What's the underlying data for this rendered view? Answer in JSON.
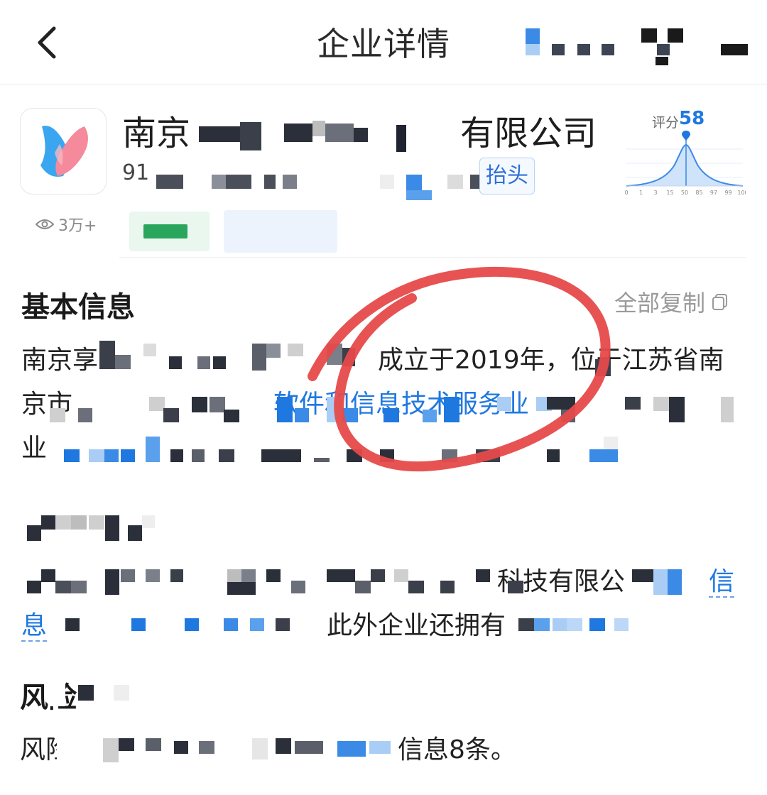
{
  "header": {
    "title": "企业详情"
  },
  "company": {
    "name_start": "南京",
    "name_end": "有限公司",
    "credit_code_start": "91",
    "tag_text": "抬头",
    "views": "3万+"
  },
  "score": {
    "label": "评分",
    "value": "58",
    "ticks": [
      "0",
      "1",
      "3",
      "15",
      "50",
      "85",
      "97",
      "99",
      "100"
    ]
  },
  "basic_info": {
    "title": "基本信息",
    "copy_all": "全部复制",
    "line1_start": "南京享",
    "line1_mid": "成立于2019年，位于江苏省南",
    "line2_start": "京市",
    "line2_link": "软件和信息技术服务业",
    "line3_start": "业",
    "line4_end": "科技有限公",
    "line4_link": "信",
    "line5_start": "息",
    "line5_mid": "此外企业还拥有"
  },
  "risk": {
    "title": "风险",
    "line1_start": "风险",
    "line1_end": "信息8条。"
  },
  "colors": {
    "accent": "#1f78e0",
    "circle": "#e64a4a",
    "text": "#222222",
    "muted": "#9a9a9a"
  }
}
